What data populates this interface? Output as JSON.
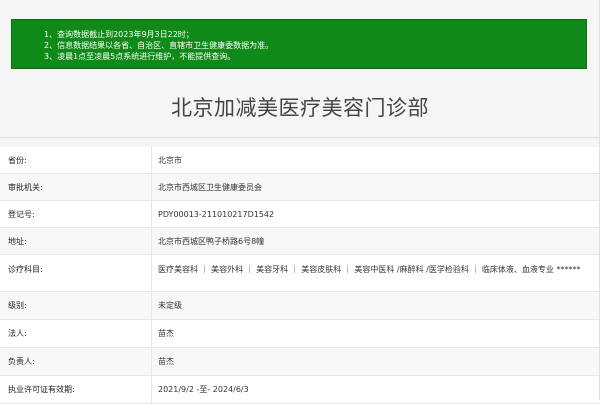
{
  "notice": {
    "lines": [
      "1、查询数据截止到2023年9月3日22时；",
      "2、信息数据结果以各省、自治区、直辖市卫生健康委数据为准。",
      "3、凌晨1点至凌晨5点系统进行维护，不能提供查询。"
    ]
  },
  "page_title": "北京加减美医疗美容门诊部",
  "rows": [
    {
      "label": "省份:",
      "value": "北京市"
    },
    {
      "label": "审批机关:",
      "value": "北京市西城区卫生健康委员会"
    },
    {
      "label": "登记号:",
      "value": "PDY00013-211010217D1542"
    },
    {
      "label": "地址:",
      "value": "北京市西城区鸭子桥路6号8幢"
    },
    {
      "label": "诊疗科目:",
      "value": "医疗美容科 ｜ 美容外科 ｜ 美容牙科 ｜ 美容皮肤科 ｜ 美容中医科 /麻醉科 /医学检验科 ｜ 临床体液、血液专业 ******"
    },
    {
      "label": "级别:",
      "value": "未定级"
    },
    {
      "label": "法人:",
      "value": "苗杰"
    },
    {
      "label": "负责人:",
      "value": "苗杰"
    },
    {
      "label": "执业许可证有效期:",
      "value": "2021/9/2 -至- 2024/6/3"
    }
  ],
  "colors": {
    "notice_bg": "#0f8a18",
    "page_bg": "#f5f5f5"
  }
}
